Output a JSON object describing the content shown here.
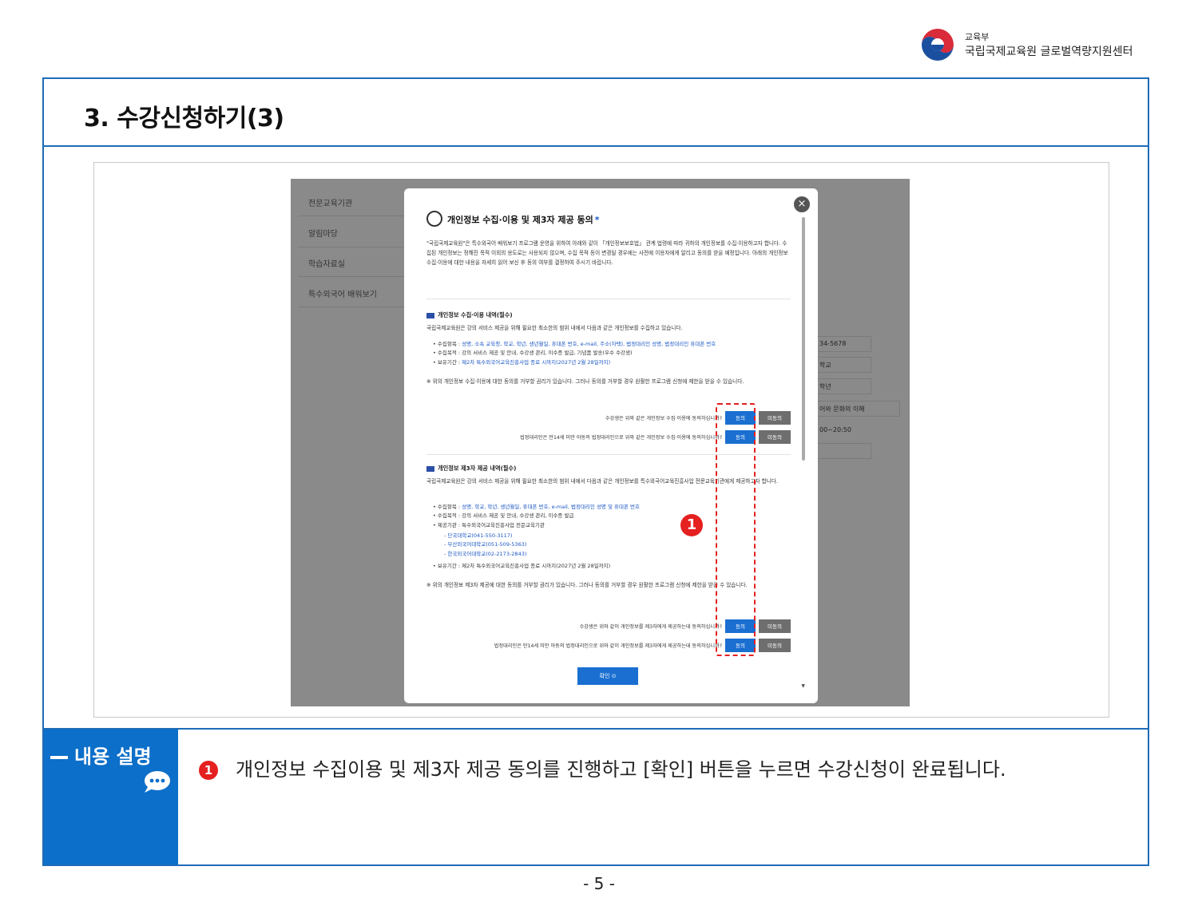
{
  "header": {
    "ministry": "교육부",
    "center": "국립국제교육원 글로벌역량지원센터"
  },
  "page_title": "3. 수강신청하기(3)",
  "screenshot": {
    "side_menu": [
      "전문교육기관",
      "알림마당",
      "학습자료실",
      "특수외국어 배워보기"
    ],
    "bg_fields": [
      "34-5678",
      "학교",
      "학년",
      "어와 문화의 이해",
      "00~20:50",
      ""
    ],
    "modal": {
      "close_icon": "close-icon",
      "title": "개인정보 수집·이용 및 제3자 제공 동의",
      "required_mark": "*",
      "intro": "\"국립국제교육원\"은 특수외국어 배워보기 프로그램 운영을 위하여 아래와 같이 「개인정보보호법」 관계 법령에 따라 귀하의 개인정보를 수집·이용하고자 합니다. 수집된 개인정보는 정해진 목적 이외의 용도로는 사용되지 않으며, 수집 목적 등이 변경될 경우에는 사전에 이용자에게 알리고 동의를 받을 예정입니다. 아래의 개인정보 수집·이용에 대한 내용을 자세히 읽어 보신 후 동의 여부를 결정하여 주시기 바랍니다.",
      "section1": {
        "title": "개인정보 수집·이용 내역(필수)",
        "desc": "국립국제교육원은 강의 서비스 제공을 위해 필요한 최소한의 범위 내에서 다음과 같은 개인정보를 수집하고 있습니다.",
        "items": [
          {
            "label": "수집항목 : ",
            "value": "성명, 소속 교육청, 학교, 학년, 생년월일, 휴대폰 번호, e-mail, 주소(자택), 법정대리인 성명, 법정대리인 휴대폰 번호"
          },
          {
            "label": "수집목적 : ",
            "value": "강의 서비스 제공 및 안내, 수강생 관리, 이수증 발급, 기념품 발송(우수 수강생)"
          },
          {
            "label": "보유기간 : ",
            "value": "제2차 특수외국어교육진흥사업 종료 시까지(2027년 2월 28일까지)"
          }
        ],
        "notice": "※ 위의 개인정보 수집·이용에 대한 동의를 거부할 권리가 있습니다. 그러나 동의를 거부할 경우 원활한 프로그램 신청에 제한을 받을 수 있습니다.",
        "q1": "수강생은 위와 같은 개인정보 수집·이용에 동의하십니까?",
        "q2": "법정대리인은 만14세 미만 아동의 법정대리인으로 위와 같은 개인정보 수집·이용에 동의하십니까?"
      },
      "section2": {
        "title": "개인정보 제3자 제공 내역(필수)",
        "desc": "국립국제교육원은 강의 서비스 제공을 위해 필요한 최소한의 범위 내에서 다음과 같은 개인정보를 특수외국어교육진흥사업 전문교육기관에게 제공하고자 합니다.",
        "items": [
          {
            "label": "수집항목 : ",
            "value": "성명, 학교, 학년, 생년월일, 휴대폰 번호, e-mail, 법정대리인 성명 및 휴대폰 번호"
          },
          {
            "label": "수집목적 : ",
            "value": "강의 서비스 제공 및 안내, 수강생 관리, 이수증 발급"
          },
          {
            "label": "제공기관 : ",
            "value": "특수외국어교육진흥사업 전문교육기관"
          }
        ],
        "institutions": [
          "단국대학교(041-550-3117)",
          "부산외국어대학교(051-509-5363)",
          "한국외국어대학교(02-2173-2843)"
        ],
        "period": {
          "label": "보유기간 : ",
          "value": "제2차 특수외국어교육진흥사업 종료 시까지(2027년 2월 28일까지)"
        },
        "notice": "※ 위의 개인정보 제3자 제공에 대한 동의를 거부할 권리가 있습니다. 그러나 동의를 거부할 경우 원활한 프로그램 신청에 제한을 받을 수 있습니다.",
        "q1": "수강생은 위와 같이 개인정보를 제3자에게 제공하는데 동의하십니까?",
        "q2": "법정대리인은 만14세 미만 아동의 법정대리인으로 위와 같이 개인정보를 제3자에게 제공하는데 동의하십니까?"
      },
      "agree_label": "동의",
      "disagree_label": "미동의",
      "confirm_label": "확인 ⊙"
    },
    "marker": "1"
  },
  "description": {
    "label": "내용 설명",
    "number": "1",
    "text": "개인정보 수집이용 및 제3자 제공 동의를 진행하고 [확인] 버튼을 누르면 수강신청이 완료됩니다."
  },
  "page_number": "- 5 -",
  "colors": {
    "frame": "#1e6bb8",
    "label_bg": "#0c6fc9",
    "marker": "#e52020",
    "agree": "#1a6fd1",
    "disagree": "#6e6e6e"
  }
}
